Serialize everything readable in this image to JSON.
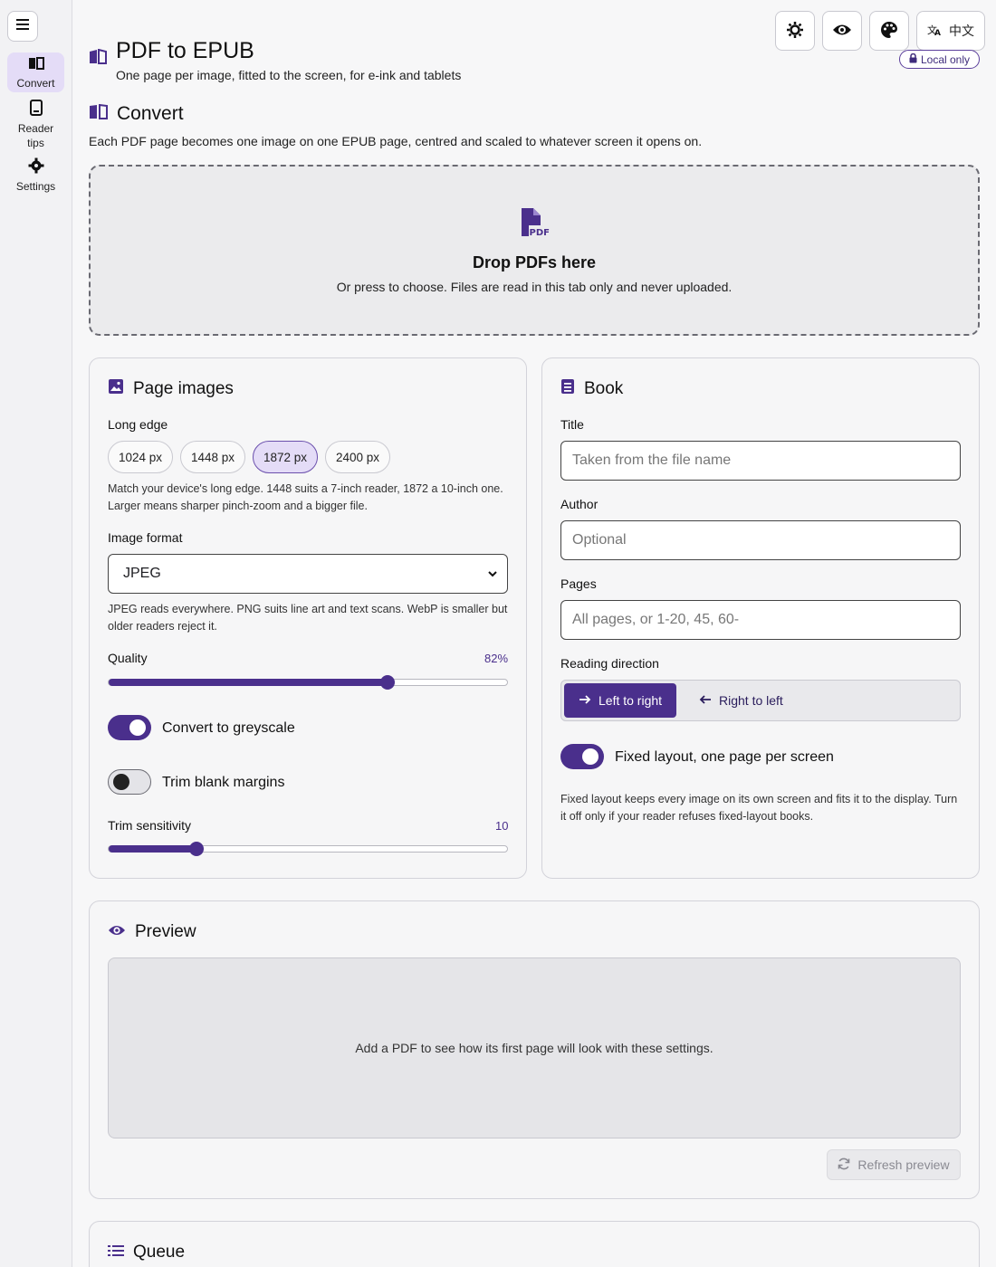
{
  "sidebar": {
    "items": [
      {
        "label": "Convert"
      },
      {
        "label": "Reader tips"
      },
      {
        "label": "Settings"
      }
    ]
  },
  "header": {
    "title": "PDF to EPUB",
    "subtitle": "One page per image, fitted to the screen, for e-ink and tablets",
    "language_label": "中文",
    "badge": "Local only"
  },
  "convert": {
    "title": "Convert",
    "description": "Each PDF page becomes one image on one EPUB page, centred and scaled to whatever screen it opens on.",
    "drop_title": "Drop PDFs here",
    "drop_sub": "Or press to choose. Files are read in this tab only and never uploaded."
  },
  "page_images": {
    "title": "Page images",
    "long_edge_label": "Long edge",
    "options": [
      "1024 px",
      "1448 px",
      "1872 px",
      "2400 px"
    ],
    "selected_index": 2,
    "long_edge_help": "Match your device's long edge. 1448 suits a 7-inch reader, 1872 a 10-inch one. Larger means sharper pinch-zoom and a bigger file.",
    "format_label": "Image format",
    "format_value": "JPEG",
    "format_help": "JPEG reads everywhere. PNG suits line art and text scans. WebP is smaller but older readers reject it.",
    "quality_label": "Quality",
    "quality_display": "82%",
    "quality_fraction": 0.7,
    "greyscale_label": "Convert to greyscale",
    "greyscale_on": true,
    "trim_label": "Trim blank margins",
    "trim_on": false,
    "sensitivity_label": "Trim sensitivity",
    "sensitivity_display": "10",
    "sensitivity_fraction": 0.22
  },
  "book": {
    "title": "Book",
    "title_label": "Title",
    "title_placeholder": "Taken from the file name",
    "author_label": "Author",
    "author_placeholder": "Optional",
    "pages_label": "Pages",
    "pages_placeholder": "All pages, or 1-20, 45, 60-",
    "direction_label": "Reading direction",
    "ltr_label": "Left to right",
    "rtl_label": "Right to left",
    "fixed_label": "Fixed layout, one page per screen",
    "fixed_on": true,
    "fixed_help": "Fixed layout keeps every image on its own screen and fits it to the display. Turn it off only if your reader refuses fixed-layout books."
  },
  "preview": {
    "title": "Preview",
    "empty_text": "Add a PDF to see how its first page will look with these settings.",
    "refresh_label": "Refresh preview"
  },
  "queue": {
    "title": "Queue"
  },
  "colors": {
    "accent": "#4a2f8c",
    "accent_light": "#e4dcf7"
  }
}
